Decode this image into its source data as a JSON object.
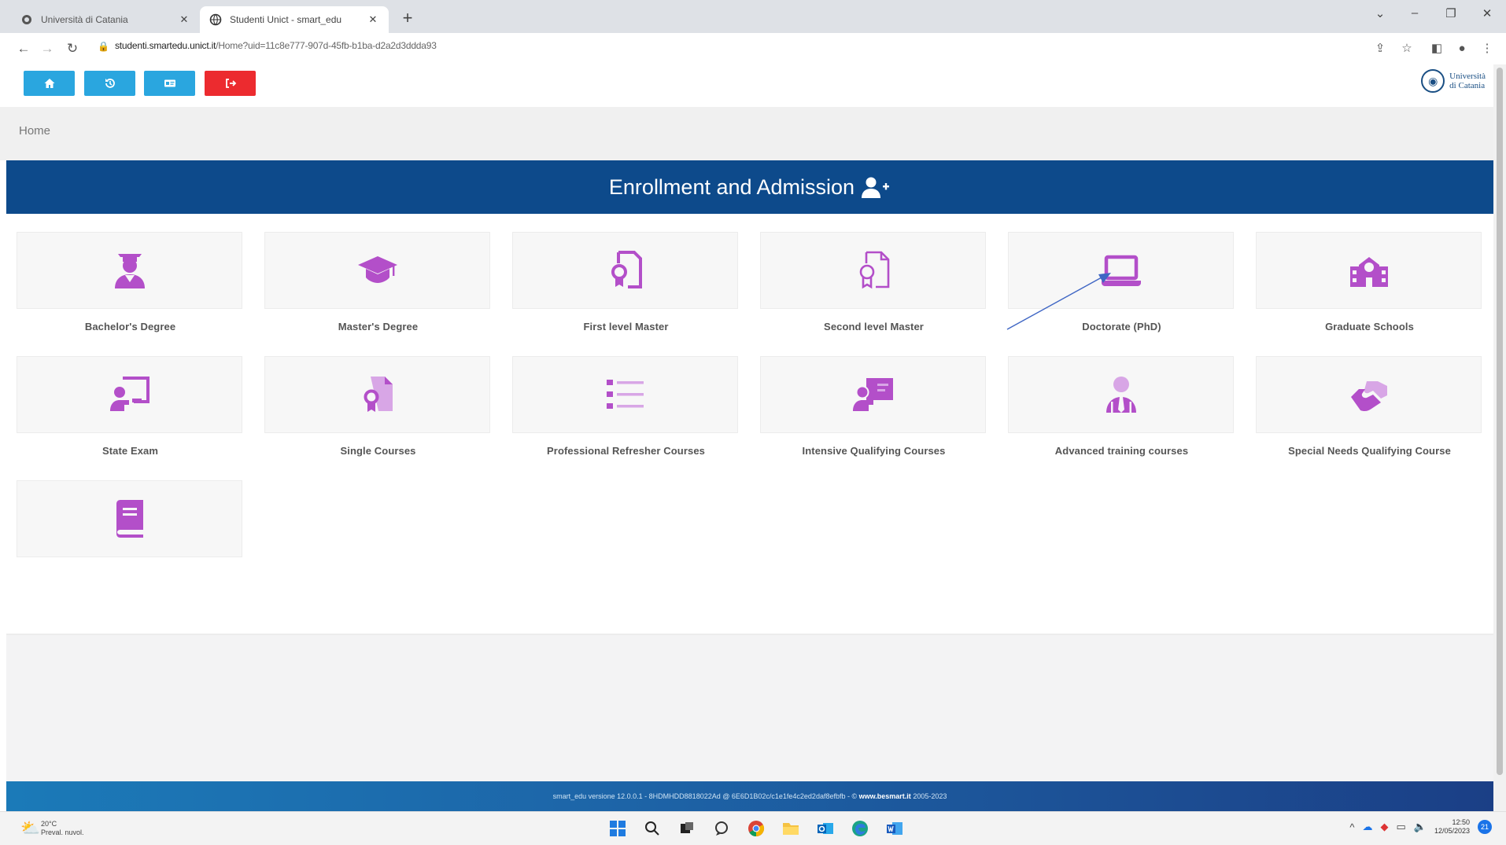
{
  "browser": {
    "tabs": [
      {
        "title": "Università di Catania",
        "active": false,
        "favicon": "unict-favicon-icon"
      },
      {
        "title": "Studenti Unict - smart_edu",
        "active": true,
        "favicon": "smartedu-favicon-icon"
      }
    ],
    "url_host": "studenti.smartedu.unict.it",
    "url_path": "/Home?uid=11c8e777-907d-45fb-b1ba-d2a2d3ddda93",
    "window_controls": {
      "chevron": "⌄",
      "minimize": "–",
      "restore": "❐",
      "close": "✕"
    }
  },
  "header": {
    "buttons": [
      {
        "name": "home-button",
        "icon": "home-icon",
        "color": "#2aa6df"
      },
      {
        "name": "history-button",
        "icon": "history-icon",
        "color": "#2aa6df"
      },
      {
        "name": "id-card-button",
        "icon": "id-card-icon",
        "color": "#2aa6df"
      },
      {
        "name": "logout-button",
        "icon": "logout-icon",
        "color": "#ec2b2f"
      }
    ],
    "logo": {
      "line1": "Università",
      "line2": "di Catania"
    }
  },
  "breadcrumb": "Home",
  "banner": {
    "title": "Enrollment and Admission",
    "icon": "user-plus-icon",
    "color": "#0d4a8b"
  },
  "tiles": [
    {
      "label": "Bachelor's Degree",
      "icon": "graduate-user-icon"
    },
    {
      "label": "Master's Degree",
      "icon": "graduation-cap-icon"
    },
    {
      "label": "First level Master",
      "icon": "certificate-document-icon"
    },
    {
      "label": "Second level Master",
      "icon": "certificate-document-outline-icon"
    },
    {
      "label": "Doctorate (PhD)",
      "icon": "laptop-icon"
    },
    {
      "label": "Graduate Schools",
      "icon": "school-building-icon"
    },
    {
      "label": "State Exam",
      "icon": "chalkboard-teacher-icon"
    },
    {
      "label": "Single Courses",
      "icon": "certificate-file-icon"
    },
    {
      "label": "Professional Refresher Courses",
      "icon": "list-icon"
    },
    {
      "label": "Intensive Qualifying Courses",
      "icon": "presentation-user-icon"
    },
    {
      "label": "Advanced training courses",
      "icon": "user-tie-icon"
    },
    {
      "label": "Special Needs Qualifying Course",
      "icon": "hands-helping-icon"
    },
    {
      "label": "",
      "icon": "book-icon"
    }
  ],
  "accent_color": "#b34fc9",
  "footer": {
    "text": "smart_edu versione 12.0.0.1 - 8HDMHDD8818022Ad @ 6E6D1B02c/c1e1fe4c2ed2daf8efbfb - ©",
    "brand": "www.besmart.it",
    "years": "2005-2023"
  },
  "taskbar": {
    "weather_temp": "20°C",
    "weather_desc": "Preval. nuvol.",
    "time": "12:50",
    "date": "12/05/2023",
    "notifications": "21"
  }
}
